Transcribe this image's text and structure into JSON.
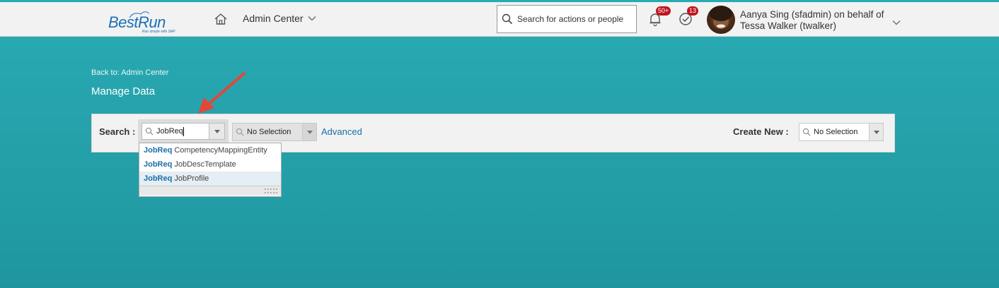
{
  "header": {
    "logo_text": "BestRun",
    "logo_tagline": "Run simple with SAP",
    "nav_label": "Admin Center",
    "search_placeholder": "Search for actions or people",
    "notifications_count": "50+",
    "todo_count": "13",
    "user_line1": "Aanya Sing (sfadmin) on behalf of",
    "user_line2": "Tessa Walker (twalker)"
  },
  "page": {
    "back_link": "Back to: Admin Center",
    "title": "Manage Data"
  },
  "toolbar": {
    "search_label": "Search :",
    "search_value": "JobReq",
    "second_select": "No Selection",
    "advanced_link": "Advanced",
    "create_label": "Create New :",
    "create_select": "No Selection"
  },
  "suggestions": [
    {
      "prefix": "JobReq",
      "rest": "CompetencyMappingEntity"
    },
    {
      "prefix": "JobReq",
      "rest": "JobDescTemplate"
    },
    {
      "prefix": "JobReq",
      "rest": "JobProfile"
    }
  ],
  "colors": {
    "accent": "#2aabb4",
    "link": "#1a6fa8",
    "badge": "#c0141e",
    "arrow": "#e2473a"
  }
}
